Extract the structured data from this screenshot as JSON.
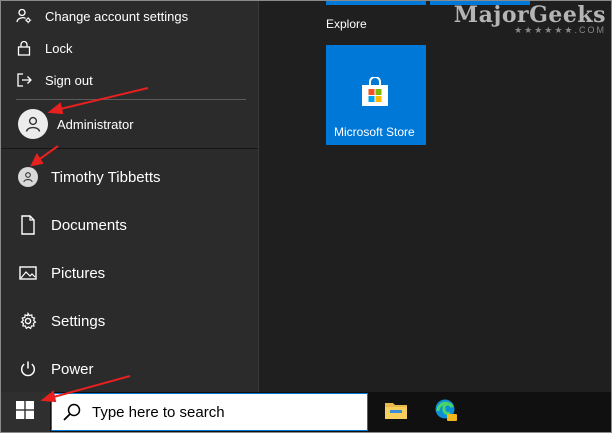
{
  "account_flyout": {
    "items": [
      {
        "label": "Change account settings",
        "icon": "person-settings-icon"
      },
      {
        "label": "Lock",
        "icon": "lock-icon"
      },
      {
        "label": "Sign out",
        "icon": "sign-out-icon"
      }
    ],
    "other_user": {
      "label": "Administrator",
      "icon": "user-avatar-icon"
    }
  },
  "left_rail": {
    "items": [
      {
        "label": "Timothy Tibbetts",
        "icon": "user-avatar-icon"
      },
      {
        "label": "Documents",
        "icon": "document-icon"
      },
      {
        "label": "Pictures",
        "icon": "pictures-icon"
      },
      {
        "label": "Settings",
        "icon": "gear-icon"
      },
      {
        "label": "Power",
        "icon": "power-icon"
      }
    ]
  },
  "tiles": {
    "group_label": "Explore",
    "store_tile": {
      "label": "Microsoft Store",
      "icon": "store-bag-icon"
    }
  },
  "watermark": {
    "text": "MajorGeeks",
    "sub": "★★★★★★.COM"
  },
  "taskbar": {
    "search_placeholder": "Type here to search",
    "pinned": [
      {
        "name": "File Explorer",
        "icon": "folder-icon"
      },
      {
        "name": "Microsoft Edge Canary",
        "icon": "edge-canary-icon"
      }
    ]
  },
  "colors": {
    "accent": "#0078d7",
    "menu_bg": "#1f1f1f",
    "rail_bg": "#2b2b2b",
    "taskbar_bg": "#101010",
    "annotation_arrow": "#e8201f"
  }
}
